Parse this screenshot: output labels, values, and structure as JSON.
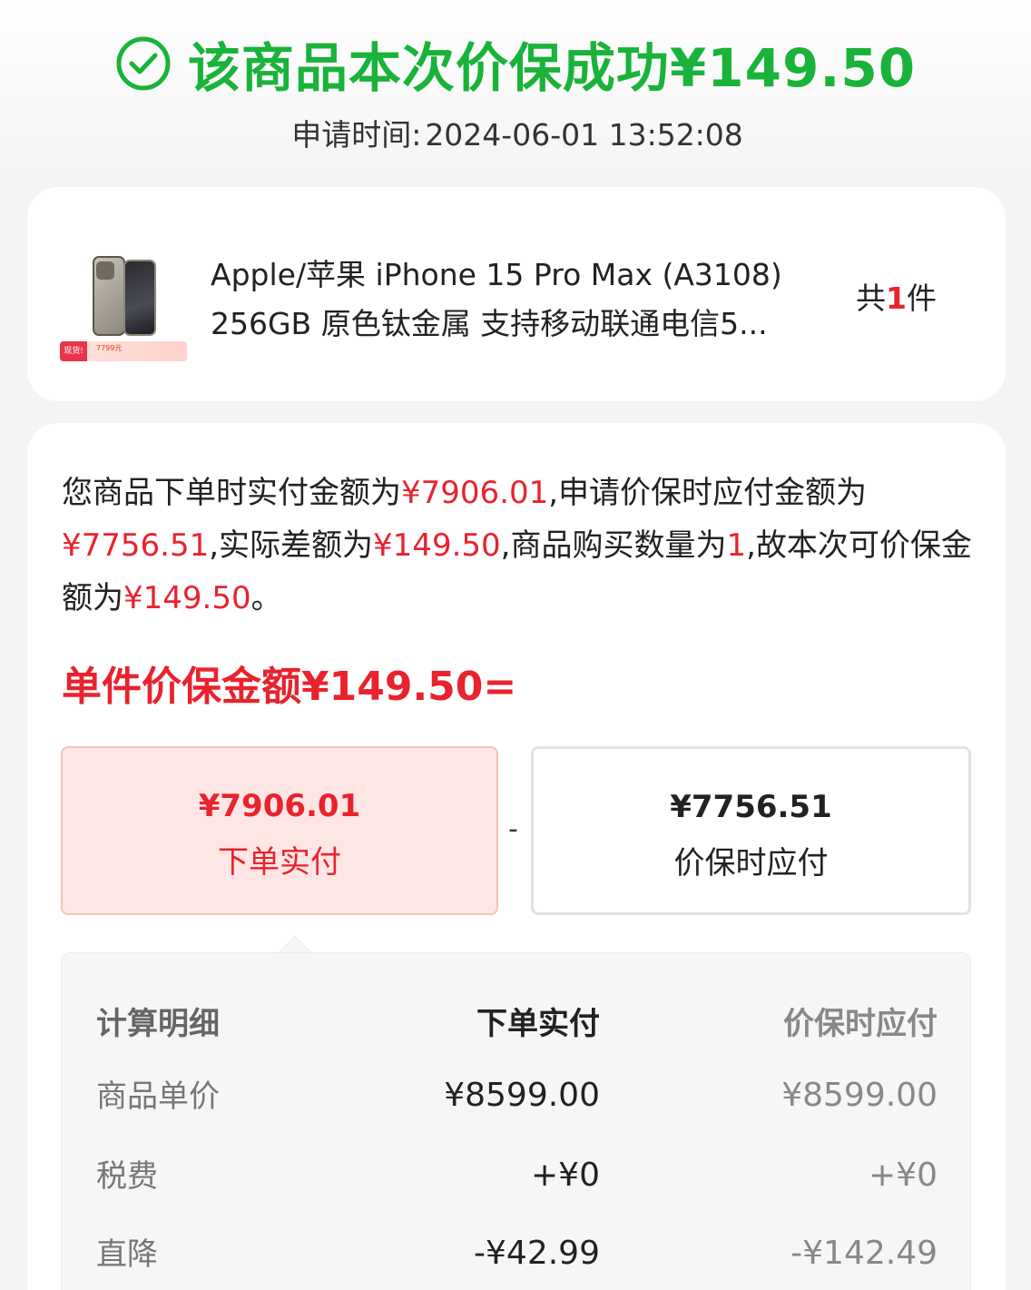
{
  "header": {
    "title": "该商品本次价保成功¥149.50",
    "apply_time_label": "申请时间:",
    "apply_time_value": "2024-06-01 13:52:08"
  },
  "product": {
    "name_line1": "Apple/苹果 iPhone 15 Pro Max (A3108)",
    "name_line2": "256GB 原色钛金属 支持移动联通电信5...",
    "qty_prefix": "共",
    "qty_num": "1",
    "qty_suffix": "件",
    "thumb_badge": "现货!",
    "thumb_price": "7799元"
  },
  "explain": {
    "p1": "您商品下单时实付金额为",
    "v1": "¥7906.01",
    "p2": ",申请价保时应付金额为",
    "v2": "¥7756.51",
    "p3": ",实际差额为",
    "v3": "¥149.50",
    "p4": ",商品购买数量为",
    "v4": "1",
    "p5": ",故本次可价保金额为",
    "v5": "¥149.50",
    "p6": "。"
  },
  "unit_title": "单件价保金额¥149.50=",
  "boxes": {
    "left_amount": "¥7906.01",
    "left_label": "下单实付",
    "minus": "-",
    "right_amount": "¥7756.51",
    "right_label": "价保时应付"
  },
  "calc": {
    "headers": [
      "计算明细",
      "下单实付",
      "价保时应付"
    ],
    "rows": [
      [
        "商品单价",
        "¥8599.00",
        "¥8599.00"
      ],
      [
        "税费",
        "+¥0",
        "+¥0"
      ],
      [
        "直降",
        "-¥42.99",
        "-¥142.49"
      ]
    ]
  },
  "colors": {
    "success_green": "#19b33a",
    "accent_red": "#e8232e"
  }
}
